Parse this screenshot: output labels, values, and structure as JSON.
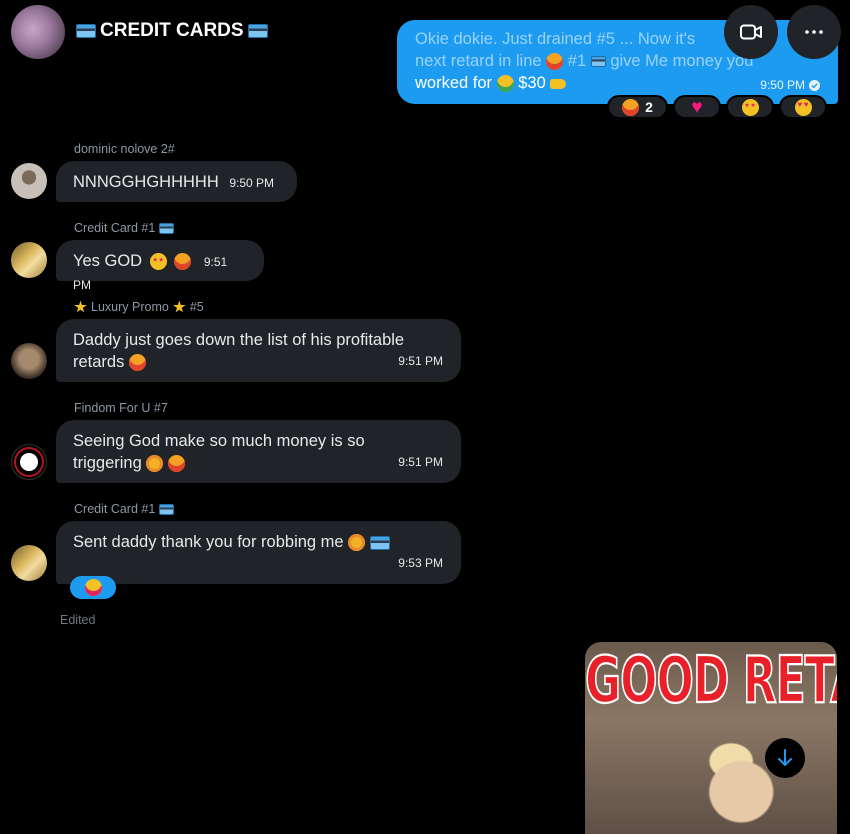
{
  "header": {
    "title": "CREDIT CARDS"
  },
  "outgoing_message": {
    "line1": "Okie dokie. Just drained #5 ... Now it's",
    "line2_before": "next retard in line",
    "line2_after": "#1",
    "line2_end": "give Me money you",
    "line3_before": "worked for",
    "line3_amount": "$30",
    "time": "9:50 PM",
    "reactions": [
      {
        "emoji": "angry-icon",
        "count": "2"
      },
      {
        "emoji": "heart-icon",
        "count": ""
      },
      {
        "emoji": "starstruck-icon",
        "count": ""
      },
      {
        "emoji": "heart-eyes-icon",
        "count": ""
      }
    ]
  },
  "messages": [
    {
      "sender": "dominic nolove 2#",
      "text": "NNNGGHGHHHHH",
      "time": "9:50 PM"
    },
    {
      "sender": "Credit Card #1",
      "text": "Yes GOD",
      "time": "9:51 PM"
    },
    {
      "sender": "Luxury Promo",
      "sender_suffix": "#5",
      "text_line1": "Daddy just goes down the list of his profitable",
      "text_line2": "retards",
      "time": "9:51 PM"
    },
    {
      "sender": "Findom For U #7",
      "text_line1": "Seeing God make so much money is so",
      "text_line2": "triggering",
      "time": "9:51 PM"
    },
    {
      "sender": "Credit Card #1",
      "text": "Sent daddy thank you for robbing me",
      "time": "9:53 PM"
    }
  ],
  "edited_label": "Edited",
  "media": {
    "overlay_text": "GOOD RETARD"
  }
}
